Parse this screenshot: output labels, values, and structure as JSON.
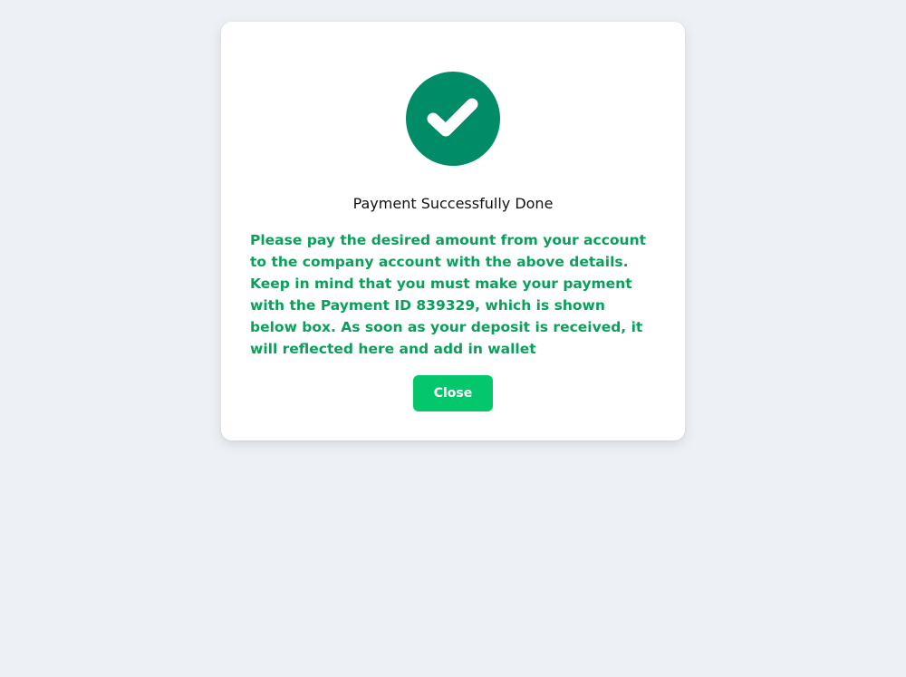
{
  "modal": {
    "icon": "checkmark-circle-icon",
    "icon_color": "#008c67",
    "title": "Payment Successfully Done",
    "message": "Please pay the desired amount from your account to the company account with the above details. Keep in mind that you must make your payment with the Payment ID 839329, which is shown below box. As soon as your deposit is received, it will reflected here and add in wallet",
    "message_color": "#0aa05c",
    "close_label": "Close",
    "close_color": "#04c66a"
  }
}
